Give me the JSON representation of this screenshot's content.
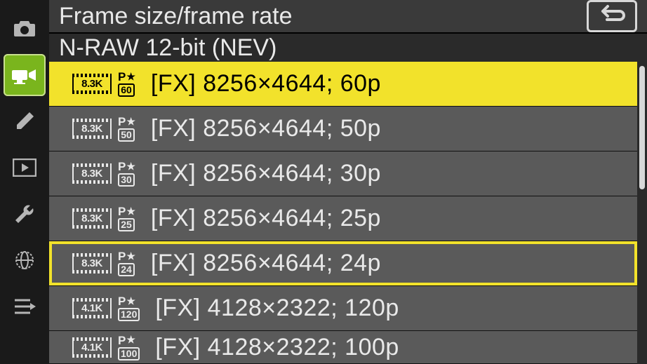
{
  "header": {
    "title": "Frame size/frame rate"
  },
  "subtitle": "N-RAW 12-bit (NEV)",
  "sidebar": {
    "items": [
      {
        "name": "photo-icon"
      },
      {
        "name": "video-icon"
      },
      {
        "name": "pencil-icon"
      },
      {
        "name": "playback-icon"
      },
      {
        "name": "wrench-icon"
      },
      {
        "name": "network-icon"
      },
      {
        "name": "mymenu-icon"
      }
    ],
    "active_index": 1
  },
  "options": [
    {
      "res": "8.3K",
      "fps_box": "60",
      "label": "[FX] 8256×4644;   60p",
      "selected": true,
      "outlined": false
    },
    {
      "res": "8.3K",
      "fps_box": "50",
      "label": "[FX] 8256×4644;   50p",
      "selected": false,
      "outlined": false
    },
    {
      "res": "8.3K",
      "fps_box": "30",
      "label": "[FX] 8256×4644;   30p",
      "selected": false,
      "outlined": false
    },
    {
      "res": "8.3K",
      "fps_box": "25",
      "label": "[FX] 8256×4644;   25p",
      "selected": false,
      "outlined": false
    },
    {
      "res": "8.3K",
      "fps_box": "24",
      "label": "[FX] 8256×4644;   24p",
      "selected": false,
      "outlined": true
    },
    {
      "res": "4.1K",
      "fps_box": "120",
      "label": "[FX] 4128×2322; 120p",
      "selected": false,
      "outlined": false
    },
    {
      "res": "4.1K",
      "fps_box": "100",
      "label": "[FX] 4128×2322; 100p",
      "selected": false,
      "outlined": false
    }
  ]
}
